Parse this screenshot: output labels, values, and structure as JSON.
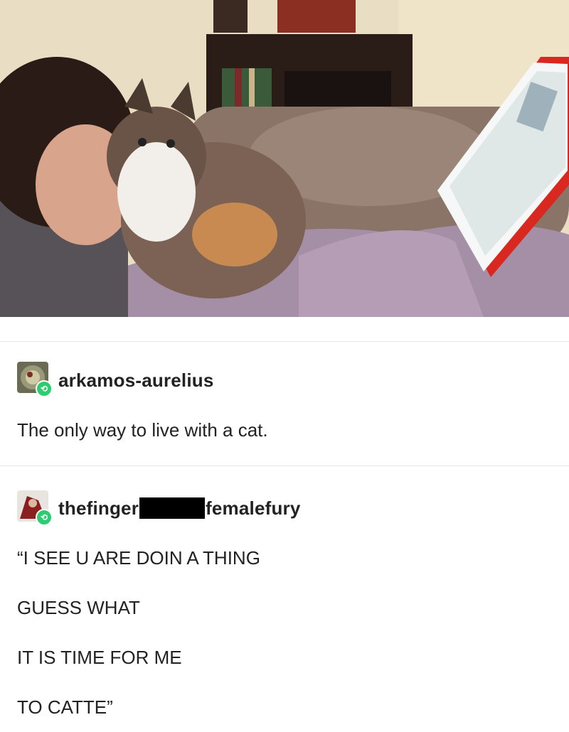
{
  "post1": {
    "username": "arkamos-aurelius",
    "text": "The only way to live with a cat."
  },
  "post2": {
    "username_prefix": "thefinger",
    "username_suffix": "femalefury",
    "lines": [
      "“I SEE U ARE DOIN A THING",
      "GUESS WHAT",
      "IT IS TIME FOR ME",
      "TO CATTE”"
    ]
  },
  "icons": {
    "reblog": "reblog-icon"
  },
  "colors": {
    "reblog_badge": "#2ecc71",
    "redaction": "#000000"
  }
}
